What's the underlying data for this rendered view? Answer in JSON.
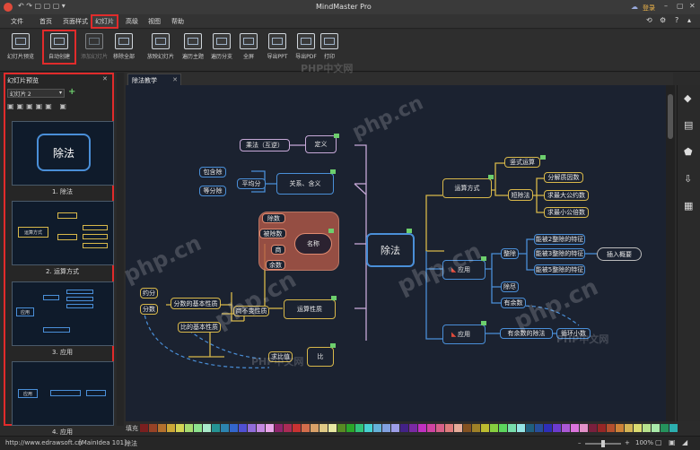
{
  "window": {
    "title": "MindMaster Pro",
    "login_label": "登录"
  },
  "menu": [
    "文件",
    "首页",
    "页面样式",
    "幻灯片",
    "高级",
    "视图",
    "帮助"
  ],
  "ribbon": [
    "幻灯片预览",
    "自动创建",
    "添加幻灯片",
    "移除全部",
    "放映幻灯片",
    "遍历主题",
    "遍历分支",
    "全屏",
    "导出PPT",
    "导出PDF",
    "打印"
  ],
  "left_panel": {
    "title": "幻灯片预览",
    "select_value": "幻灯片 2",
    "captions": [
      "1. 除法",
      "2. 运算方式",
      "3. 应用",
      "4. 应用"
    ],
    "thumb_texts": {
      "t1": "除法",
      "t2": "运算方式",
      "t3": "应用",
      "t4": "应用"
    }
  },
  "tab": {
    "label": "除法教学"
  },
  "map": {
    "center": "除法",
    "n_dingyi": "定义",
    "n_chengfa": "乘法（互逆）",
    "n_guanxi": "关系、含义",
    "n_pingjunfen": "平均分",
    "n_baohanchu": "包含除",
    "n_dengfenchu": "等分除",
    "n_mingcheng": "名称",
    "n_chushu": "除数",
    "n_beichushu": "被除数",
    "n_shang": "商",
    "n_yushu": "余数",
    "n_yunsuanxingzhi": "运算性质",
    "n_fenshu": "分数的基本性质",
    "n_yuefen": "约分",
    "n_fenshu2": "分数",
    "n_bubian": "商不变性质",
    "n_bi": "比的基本性质",
    "n_qiubizhi": "求比值",
    "n_bi2": "比",
    "n_yunsuanfangshi": "运算方式",
    "n_shushi": "竖式运算",
    "n_duanchu": "短除法",
    "n_fenjie": "分解质因数",
    "n_zuida": "求最大公约数",
    "n_zuixiao": "求最小公倍数",
    "n_yingyong1": "应用",
    "n_zhengchu": "整除",
    "n_t2": "能被2整除的特征",
    "n_t3": "能被3整除的特征",
    "n_t5": "能被5整除的特征",
    "n_chaji": "插入概要",
    "n_chujin": "除尽",
    "n_youyushu": "有余数",
    "n_yingyong2": "应用",
    "n_youyushudechufa": "有余数的除法",
    "n_xunhuan": "循环小数"
  },
  "status": {
    "url": "http://www.edrawsoft.cn",
    "main_idea": "[MainIdea 101]",
    "topic": "除法",
    "zoom": "100%",
    "fill_label": "填充"
  },
  "watermarks": [
    "php.cn",
    "PHP中文网"
  ],
  "colors": {
    "accent_red": "#e12b2b",
    "center_border": "#4a8fd8",
    "green_flag": "#6dcf6d"
  }
}
